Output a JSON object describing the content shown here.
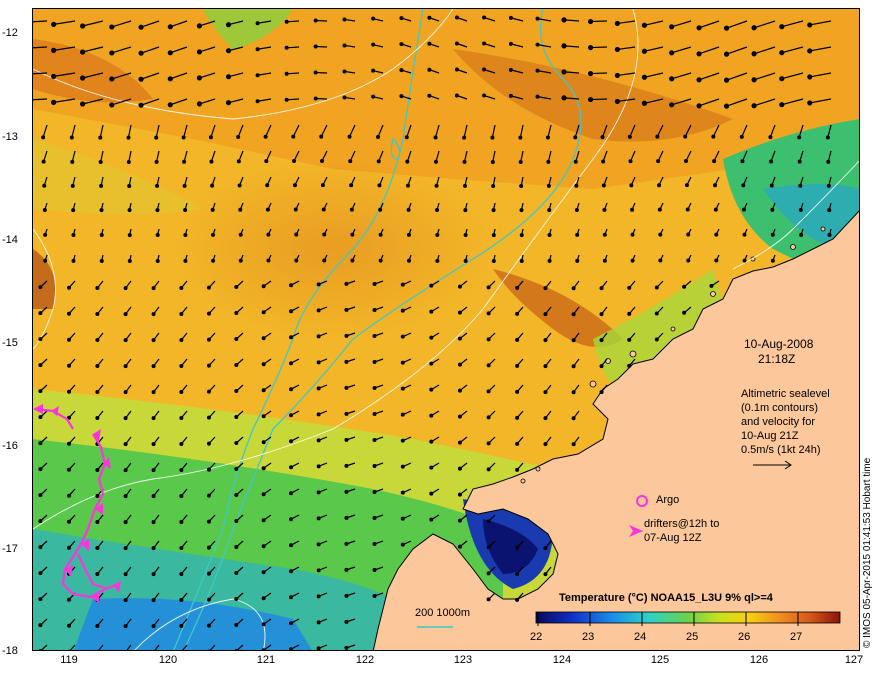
{
  "map": {
    "lat_ticks": [
      "-12",
      "-13",
      "-14",
      "-15",
      "-16",
      "-17",
      "-18"
    ],
    "lon_ticks": [
      "119",
      "120",
      "121",
      "122",
      "123",
      "124",
      "125",
      "126",
      "127"
    ],
    "lat_range": [
      -18,
      -11.8
    ],
    "lon_range": [
      118.6,
      127
    ]
  },
  "annotations": {
    "date": "10-Aug-2008",
    "time": "21:18Z",
    "altimetry_lines": [
      "Altimetric sealevel",
      "(0.1m contours)",
      "and velocity for",
      "10-Aug 21Z",
      "0.5m/s (1kt 24h)"
    ],
    "argo_label": "Argo",
    "drifters_line1": "drifters@12h to",
    "drifters_line2": "07-Aug 12Z",
    "depth_label": "200  1000m"
  },
  "colorbar": {
    "title": "Temperature (°C) NOAA15_L3U 9% ql>=4",
    "ticks": [
      "22",
      "23",
      "24",
      "25",
      "26",
      "27"
    ]
  },
  "credit": "© IMOS 05-Apr-2015 01:41:53 Hobart time",
  "colors": {
    "land": "#fbc79b",
    "sst_cold": "#0a1a7a",
    "sst_mid": "#44c256",
    "sst_warm": "#f0a020",
    "bathy_line": "#3ec8c8",
    "drifter": "#ff33dd"
  }
}
